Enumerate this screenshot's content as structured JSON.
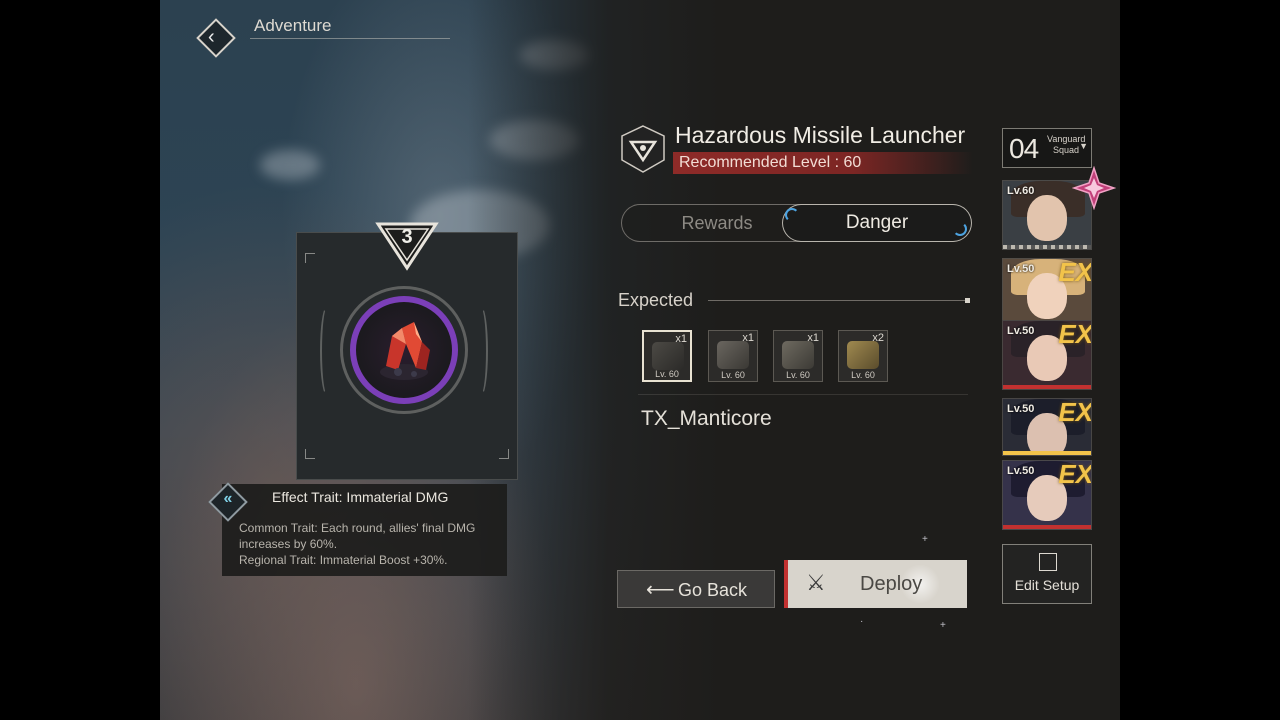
{
  "header": {
    "title": "Adventure"
  },
  "boss": {
    "name": "Hazardous Missile Launcher",
    "recommended": "Recommended Level : 60"
  },
  "tabs": {
    "rewards": "Rewards",
    "danger": "Danger"
  },
  "expected": {
    "label": "Expected",
    "items": [
      {
        "qty": "x1",
        "level": "Lv. 60",
        "selected": true
      },
      {
        "qty": "x1",
        "level": "Lv. 60",
        "selected": false
      },
      {
        "qty": "x1",
        "level": "Lv. 60",
        "selected": false
      },
      {
        "qty": "x2",
        "level": "Lv. 60",
        "selected": false
      }
    ],
    "enemy": "TX_Manticore"
  },
  "trait_card": {
    "tier": "3",
    "title": "Effect Trait: Immaterial DMG",
    "line1": "Common Trait: Each round, allies' final DMG increases by 60%.",
    "line2": "Regional Trait: Immaterial Boost +30%."
  },
  "buttons": {
    "go_back": "Go Back",
    "deploy": "Deploy",
    "edit_setup": "Edit Setup"
  },
  "squad": {
    "number": "04",
    "name": "Vanguard Squad",
    "members": [
      {
        "level": "Lv.60",
        "ex": ""
      },
      {
        "level": "Lv.50",
        "ex": "EX"
      },
      {
        "level": "Lv.50",
        "ex": "EX"
      },
      {
        "level": "Lv.50",
        "ex": "EX"
      },
      {
        "level": "Lv.50",
        "ex": "EX"
      }
    ]
  },
  "colors": {
    "accent_red": "#c23130",
    "purple_ring": "#7b3fb8",
    "ex_gold": "#f2c34a",
    "arc_blue": "#4da3e0"
  }
}
